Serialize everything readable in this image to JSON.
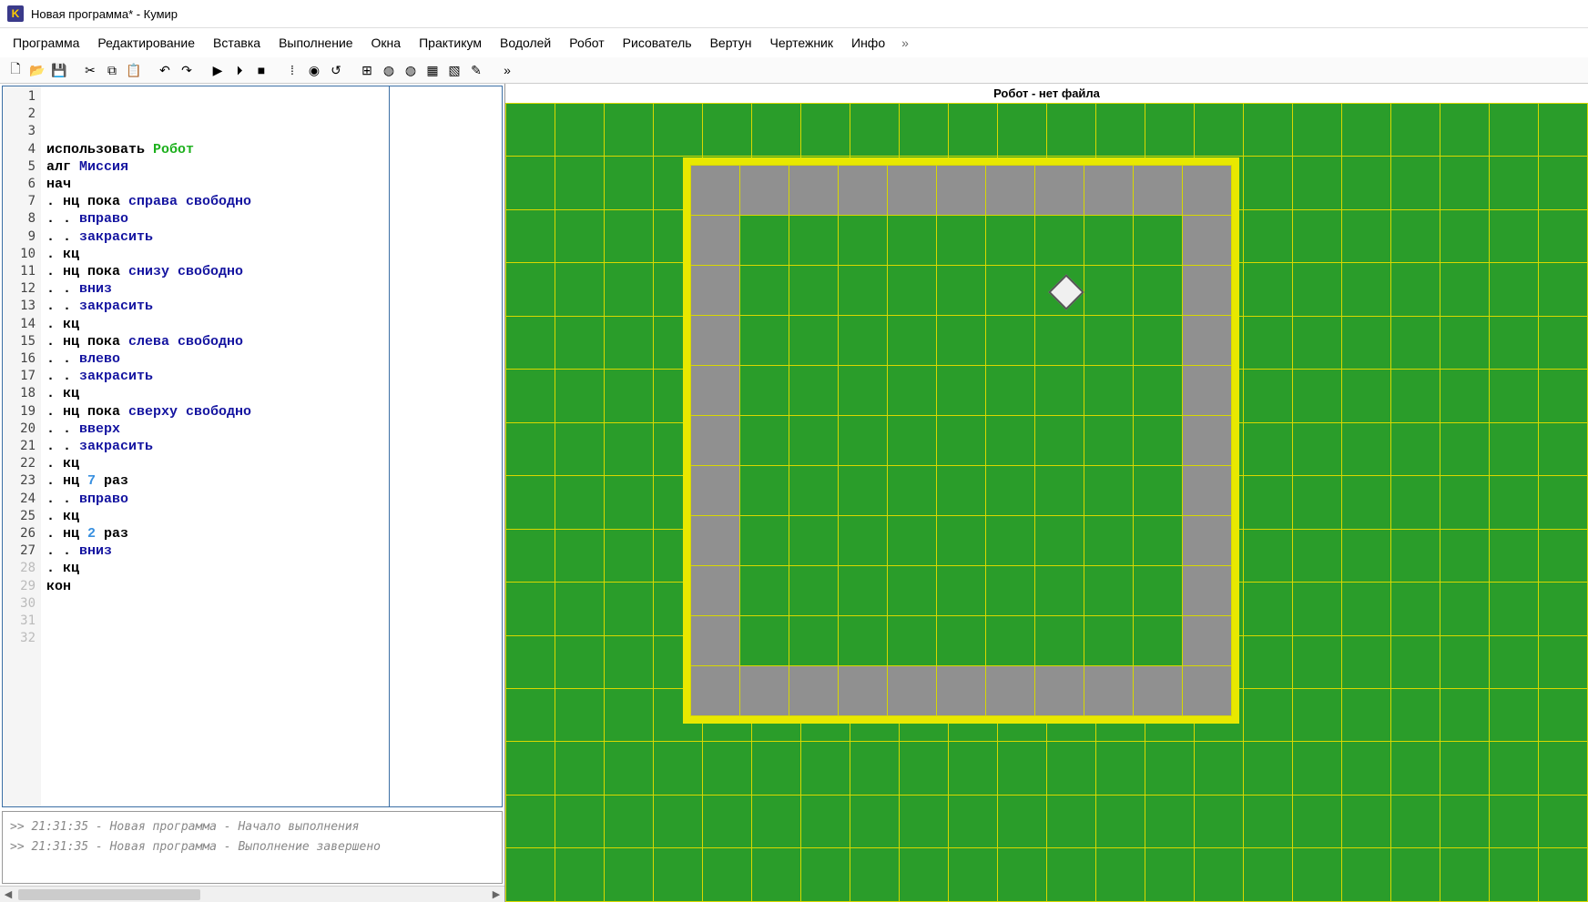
{
  "window": {
    "title": "Новая программа* - Кумир"
  },
  "menu": {
    "items": [
      "Программа",
      "Редактирование",
      "Вставка",
      "Выполнение",
      "Окна",
      "Практикум",
      "Водолей",
      "Робот",
      "Рисователь",
      "Вертун",
      "Чертежник",
      "Инфо"
    ],
    "chev": "»"
  },
  "toolbar": {
    "buttons": [
      {
        "name": "new-file-icon",
        "glyph": "🗋"
      },
      {
        "name": "open-file-icon",
        "glyph": "📂"
      },
      {
        "name": "save-file-icon",
        "glyph": "💾"
      },
      {
        "name": "sep"
      },
      {
        "name": "cut-icon",
        "glyph": "✂"
      },
      {
        "name": "copy-icon",
        "glyph": "⧉"
      },
      {
        "name": "paste-icon",
        "glyph": "📋"
      },
      {
        "name": "sep"
      },
      {
        "name": "undo-icon",
        "glyph": "↶"
      },
      {
        "name": "redo-icon",
        "glyph": "↷"
      },
      {
        "name": "sep"
      },
      {
        "name": "run-icon",
        "glyph": "▶"
      },
      {
        "name": "step-icon",
        "glyph": "⏵"
      },
      {
        "name": "stop-icon",
        "glyph": "■"
      },
      {
        "name": "sep"
      },
      {
        "name": "breakpoint-icon",
        "glyph": "⁞"
      },
      {
        "name": "watch-icon",
        "glyph": "◉"
      },
      {
        "name": "reset-icon",
        "glyph": "↺"
      },
      {
        "name": "sep"
      },
      {
        "name": "module-1-icon",
        "glyph": "⊞"
      },
      {
        "name": "module-2-icon",
        "glyph": "◍"
      },
      {
        "name": "module-3-icon",
        "glyph": "◍"
      },
      {
        "name": "module-4-icon",
        "glyph": "▦"
      },
      {
        "name": "module-5-icon",
        "glyph": "▧"
      },
      {
        "name": "module-6-icon",
        "glyph": "✎"
      },
      {
        "name": "sep"
      },
      {
        "name": "overflow-icon",
        "glyph": "»"
      }
    ]
  },
  "editor": {
    "total_lines": 32,
    "active_lines": 27,
    "lines": [
      {
        "segs": [
          {
            "t": "использовать ",
            "c": "kw-black"
          },
          {
            "t": "Робот",
            "c": "kw-green"
          }
        ]
      },
      {
        "segs": [
          {
            "t": "алг ",
            "c": "kw-black"
          },
          {
            "t": "Миссия",
            "c": "kw-blue-dk"
          }
        ]
      },
      {
        "segs": [
          {
            "t": "нач",
            "c": "kw-black"
          }
        ]
      },
      {
        "segs": [
          {
            "t": ". нц пока ",
            "c": "kw-black"
          },
          {
            "t": "справа свободно",
            "c": "kw-blue-dk"
          }
        ]
      },
      {
        "segs": [
          {
            "t": ". . ",
            "c": "kw-black"
          },
          {
            "t": "вправо",
            "c": "kw-blue-dk"
          }
        ]
      },
      {
        "segs": [
          {
            "t": ". . ",
            "c": "kw-black"
          },
          {
            "t": "закрасить",
            "c": "kw-blue-dk"
          }
        ]
      },
      {
        "segs": [
          {
            "t": ". кц",
            "c": "kw-black"
          }
        ]
      },
      {
        "segs": [
          {
            "t": ". нц пока ",
            "c": "kw-black"
          },
          {
            "t": "снизу свободно",
            "c": "kw-blue-dk"
          }
        ]
      },
      {
        "segs": [
          {
            "t": ". . ",
            "c": "kw-black"
          },
          {
            "t": "вниз",
            "c": "kw-blue-dk"
          }
        ]
      },
      {
        "segs": [
          {
            "t": ". . ",
            "c": "kw-black"
          },
          {
            "t": "закрасить",
            "c": "kw-blue-dk"
          }
        ]
      },
      {
        "segs": [
          {
            "t": ". кц",
            "c": "kw-black"
          }
        ]
      },
      {
        "segs": [
          {
            "t": ". нц пока ",
            "c": "kw-black"
          },
          {
            "t": "слева свободно",
            "c": "kw-blue-dk"
          }
        ]
      },
      {
        "segs": [
          {
            "t": ". . ",
            "c": "kw-black"
          },
          {
            "t": "влево",
            "c": "kw-blue-dk"
          }
        ]
      },
      {
        "segs": [
          {
            "t": ". . ",
            "c": "kw-black"
          },
          {
            "t": "закрасить",
            "c": "kw-blue-dk"
          }
        ]
      },
      {
        "segs": [
          {
            "t": ". кц",
            "c": "kw-black"
          }
        ]
      },
      {
        "segs": [
          {
            "t": ". нц пока ",
            "c": "kw-black"
          },
          {
            "t": "сверху свободно",
            "c": "kw-blue-dk"
          }
        ]
      },
      {
        "segs": [
          {
            "t": ". . ",
            "c": "kw-black"
          },
          {
            "t": "вверх",
            "c": "kw-blue-dk"
          }
        ]
      },
      {
        "segs": [
          {
            "t": ". . ",
            "c": "kw-black"
          },
          {
            "t": "закрасить",
            "c": "kw-blue-dk"
          }
        ]
      },
      {
        "segs": [
          {
            "t": ". кц",
            "c": "kw-black"
          }
        ]
      },
      {
        "segs": [
          {
            "t": ". нц ",
            "c": "kw-black"
          },
          {
            "t": "7",
            "c": "kw-blue-lt"
          },
          {
            "t": " раз",
            "c": "kw-black"
          }
        ]
      },
      {
        "segs": [
          {
            "t": ". . ",
            "c": "kw-black"
          },
          {
            "t": "вправо",
            "c": "kw-blue-dk"
          }
        ]
      },
      {
        "segs": [
          {
            "t": ". кц",
            "c": "kw-black"
          }
        ]
      },
      {
        "segs": [
          {
            "t": ". нц ",
            "c": "kw-black"
          },
          {
            "t": "2",
            "c": "kw-blue-lt"
          },
          {
            "t": " раз",
            "c": "kw-black"
          }
        ]
      },
      {
        "segs": [
          {
            "t": ". . ",
            "c": "kw-black"
          },
          {
            "t": "вниз",
            "c": "kw-blue-dk"
          }
        ]
      },
      {
        "segs": [
          {
            "t": ". кц",
            "c": "kw-black"
          }
        ]
      },
      {
        "segs": [
          {
            "t": "кон",
            "c": "kw-black"
          }
        ]
      },
      {
        "segs": [
          {
            "t": "",
            "c": ""
          }
        ]
      }
    ]
  },
  "console": {
    "lines": [
      ">> 21:31:35 - Новая программа - Начало выполнения",
      ">> 21:31:35 - Новая программа - Выполнение завершено"
    ]
  },
  "robot_panel": {
    "title": "Робот - нет файла",
    "arena": {
      "cols": 11,
      "rows": 11,
      "painted": [
        [
          0,
          0
        ],
        [
          0,
          1
        ],
        [
          0,
          2
        ],
        [
          0,
          3
        ],
        [
          0,
          4
        ],
        [
          0,
          5
        ],
        [
          0,
          6
        ],
        [
          0,
          7
        ],
        [
          0,
          8
        ],
        [
          0,
          9
        ],
        [
          0,
          10
        ],
        [
          1,
          0
        ],
        [
          1,
          10
        ],
        [
          2,
          0
        ],
        [
          2,
          10
        ],
        [
          3,
          0
        ],
        [
          3,
          10
        ],
        [
          4,
          0
        ],
        [
          4,
          10
        ],
        [
          5,
          0
        ],
        [
          5,
          10
        ],
        [
          6,
          0
        ],
        [
          6,
          10
        ],
        [
          7,
          0
        ],
        [
          7,
          10
        ],
        [
          8,
          0
        ],
        [
          8,
          10
        ],
        [
          9,
          0
        ],
        [
          9,
          10
        ],
        [
          10,
          0
        ],
        [
          10,
          1
        ],
        [
          10,
          2
        ],
        [
          10,
          3
        ],
        [
          10,
          4
        ],
        [
          10,
          5
        ],
        [
          10,
          6
        ],
        [
          10,
          7
        ],
        [
          10,
          8
        ],
        [
          10,
          9
        ],
        [
          10,
          10
        ]
      ],
      "robot_pos": {
        "row": 2,
        "col": 7
      }
    },
    "bg_grid": {
      "cols": 22,
      "rows": 15
    }
  }
}
